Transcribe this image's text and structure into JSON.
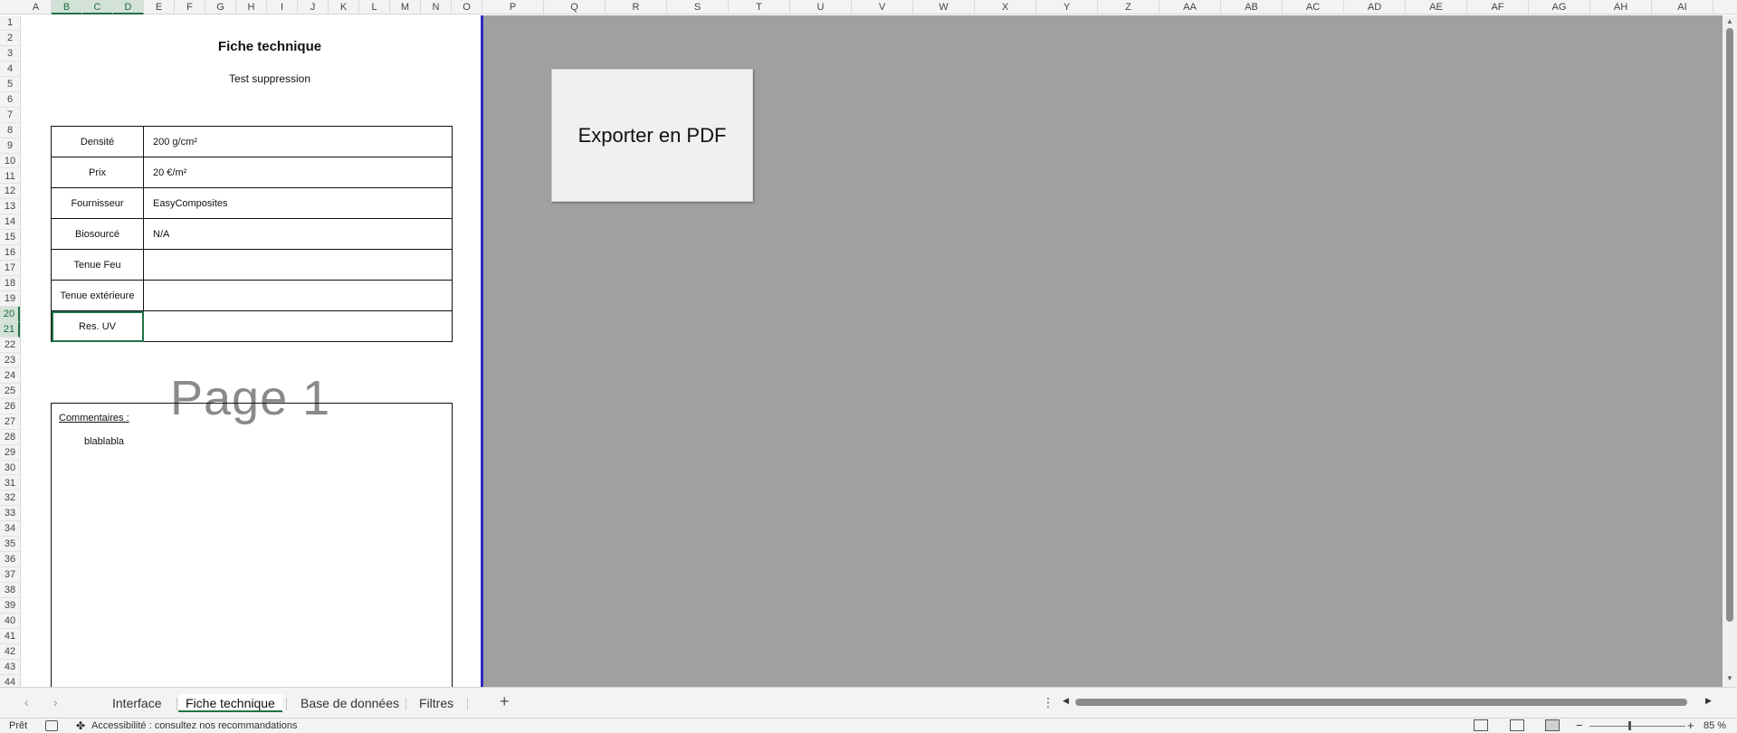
{
  "columns": [
    "A",
    "B",
    "C",
    "D",
    "E",
    "F",
    "G",
    "H",
    "I",
    "J",
    "K",
    "L",
    "M",
    "N",
    "O",
    "P",
    "Q",
    "R",
    "S",
    "T",
    "U",
    "V",
    "W",
    "X",
    "Y",
    "Z",
    "AA",
    "AB",
    "AC",
    "AD",
    "AE",
    "AF",
    "AG",
    "AH",
    "AI"
  ],
  "selected_columns": [
    "B",
    "C",
    "D"
  ],
  "rows": [
    "1",
    "2",
    "3",
    "4",
    "5",
    "6",
    "7",
    "8",
    "9",
    "10",
    "11",
    "12",
    "13",
    "14",
    "15",
    "16",
    "17",
    "18",
    "19",
    "20",
    "21",
    "22",
    "23",
    "24",
    "25",
    "26",
    "27",
    "28",
    "29",
    "30",
    "31",
    "32",
    "33",
    "34",
    "35",
    "36",
    "37",
    "38",
    "39",
    "40",
    "41",
    "42",
    "43",
    "44"
  ],
  "selected_rows": [
    "20",
    "21"
  ],
  "sheet": {
    "title": "Fiche technique",
    "subtitle": "Test suppression",
    "table": [
      {
        "label": "Densité",
        "value": "200 g/cm²"
      },
      {
        "label": "Prix",
        "value": "20 €/m²"
      },
      {
        "label": "Fournisseur",
        "value": "EasyComposites"
      },
      {
        "label": "Biosourcé",
        "value": "N/A"
      },
      {
        "label": "Tenue Feu",
        "value": ""
      },
      {
        "label": "Tenue extérieure",
        "value": ""
      },
      {
        "label": "Res. UV",
        "value": ""
      }
    ],
    "page_watermark": "Page 1",
    "comments_label": "Commentaires :",
    "comments_text": "blablabla"
  },
  "export_button_label": "Exporter en PDF",
  "tabs": [
    {
      "label": "Interface",
      "active": false
    },
    {
      "label": "Fiche technique",
      "active": true
    },
    {
      "label": "Base de données",
      "active": false
    },
    {
      "label": "Filtres",
      "active": false
    }
  ],
  "add_sheet_glyph": "+",
  "tab_more_glyph": "⋮",
  "status": {
    "ready": "Prêt",
    "accessibility": "Accessibilité : consultez nos recommandations",
    "zoom": "85 %"
  },
  "colors": {
    "accent": "#217346",
    "page_break": "#2b2bbf",
    "outside_print_area": "#a0a0a0"
  }
}
